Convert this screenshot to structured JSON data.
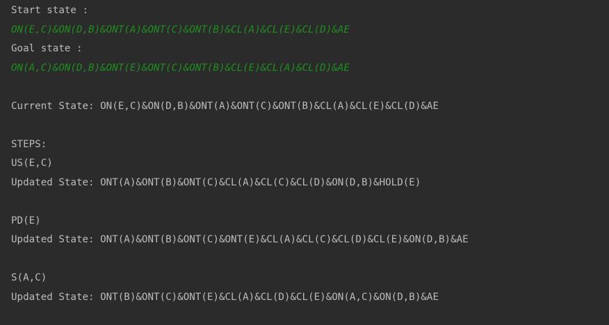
{
  "console": {
    "start_label": "Start state :",
    "start_value": "ON(E,C)&ON(D,B)&ONT(A)&ONT(C)&ONT(B)&CL(A)&CL(E)&CL(D)&AE",
    "goal_label": "Goal state :",
    "goal_value": "ON(A,C)&ON(D,B)&ONT(E)&ONT(C)&ONT(B)&CL(E)&CL(A)&CL(D)&AE",
    "current_state": "Current State: ON(E,C)&ON(D,B)&ONT(A)&ONT(C)&ONT(B)&CL(A)&CL(E)&CL(D)&AE",
    "steps_header": "STEPS:",
    "steps": [
      {
        "action": "US(E,C)",
        "updated": "Updated State: ONT(A)&ONT(B)&ONT(C)&CL(A)&CL(C)&CL(D)&ON(D,B)&HOLD(E)"
      },
      {
        "action": "PD(E)",
        "updated": "Updated State: ONT(A)&ONT(B)&ONT(C)&ONT(E)&CL(A)&CL(C)&CL(D)&CL(E)&ON(D,B)&AE"
      },
      {
        "action": "S(A,C)",
        "updated": "Updated State: ONT(B)&ONT(C)&ONT(E)&CL(A)&CL(D)&CL(E)&ON(A,C)&ON(D,B)&AE"
      }
    ]
  },
  "colors": {
    "background": "#2b2b2b",
    "text": "#bbbbbb",
    "input_echo_green": "#1e8f1e"
  }
}
